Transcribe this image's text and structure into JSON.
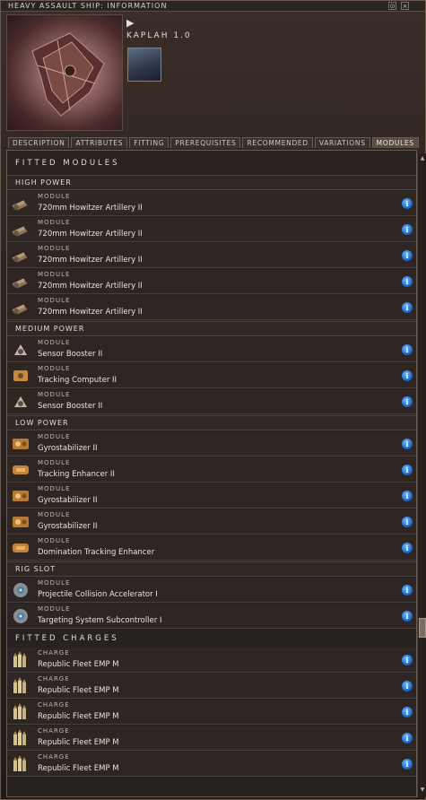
{
  "window": {
    "title": "HEAVY ASSAULT SHIP: INFORMATION"
  },
  "header": {
    "ship_name": "KAPLAH 1.0"
  },
  "tabs": [
    {
      "label": "DESCRIPTION",
      "active": false
    },
    {
      "label": "ATTRIBUTES",
      "active": false
    },
    {
      "label": "FITTING",
      "active": false
    },
    {
      "label": "PREREQUISITES",
      "active": false
    },
    {
      "label": "RECOMMENDED",
      "active": false
    },
    {
      "label": "VARIATIONS",
      "active": false
    },
    {
      "label": "MODULES",
      "active": true
    }
  ],
  "modules": {
    "title": "FITTED MODULES",
    "groups": [
      {
        "label": "HIGH POWER",
        "items": [
          {
            "kind": "MODULE",
            "name": "720mm Howitzer Artillery II",
            "icon": "artillery-icon"
          },
          {
            "kind": "MODULE",
            "name": "720mm Howitzer Artillery II",
            "icon": "artillery-icon"
          },
          {
            "kind": "MODULE",
            "name": "720mm Howitzer Artillery II",
            "icon": "artillery-icon"
          },
          {
            "kind": "MODULE",
            "name": "720mm Howitzer Artillery II",
            "icon": "artillery-icon"
          },
          {
            "kind": "MODULE",
            "name": "720mm Howitzer Artillery II",
            "icon": "artillery-icon"
          }
        ]
      },
      {
        "label": "MEDIUM POWER",
        "items": [
          {
            "kind": "MODULE",
            "name": "Sensor Booster II",
            "icon": "sensor-booster-icon"
          },
          {
            "kind": "MODULE",
            "name": "Tracking Computer II",
            "icon": "tracking-computer-icon"
          },
          {
            "kind": "MODULE",
            "name": "Sensor Booster II",
            "icon": "sensor-booster-icon"
          }
        ]
      },
      {
        "label": "LOW POWER",
        "items": [
          {
            "kind": "MODULE",
            "name": "Gyrostabilizer II",
            "icon": "gyrostabilizer-icon"
          },
          {
            "kind": "MODULE",
            "name": "Tracking Enhancer II",
            "icon": "tracking-enhancer-icon"
          },
          {
            "kind": "MODULE",
            "name": "Gyrostabilizer II",
            "icon": "gyrostabilizer-icon"
          },
          {
            "kind": "MODULE",
            "name": "Gyrostabilizer II",
            "icon": "gyrostabilizer-icon"
          },
          {
            "kind": "MODULE",
            "name": "Domination Tracking Enhancer",
            "icon": "tracking-enhancer-icon"
          }
        ]
      },
      {
        "label": "RIG SLOT",
        "items": [
          {
            "kind": "MODULE",
            "name": "Projectile Collision Accelerator I",
            "icon": "rig-icon"
          },
          {
            "kind": "MODULE",
            "name": "Targeting System Subcontroller I",
            "icon": "rig-icon"
          }
        ]
      }
    ]
  },
  "charges": {
    "title": "FITTED CHARGES",
    "items": [
      {
        "kind": "CHARGE",
        "name": "Republic Fleet EMP M",
        "icon": "ammo-icon"
      },
      {
        "kind": "CHARGE",
        "name": "Republic Fleet EMP M",
        "icon": "ammo-icon"
      },
      {
        "kind": "CHARGE",
        "name": "Republic Fleet EMP M",
        "icon": "ammo-icon"
      },
      {
        "kind": "CHARGE",
        "name": "Republic Fleet EMP M",
        "icon": "ammo-icon"
      },
      {
        "kind": "CHARGE",
        "name": "Republic Fleet EMP M",
        "icon": "ammo-icon"
      }
    ]
  },
  "info_glyph": "i"
}
